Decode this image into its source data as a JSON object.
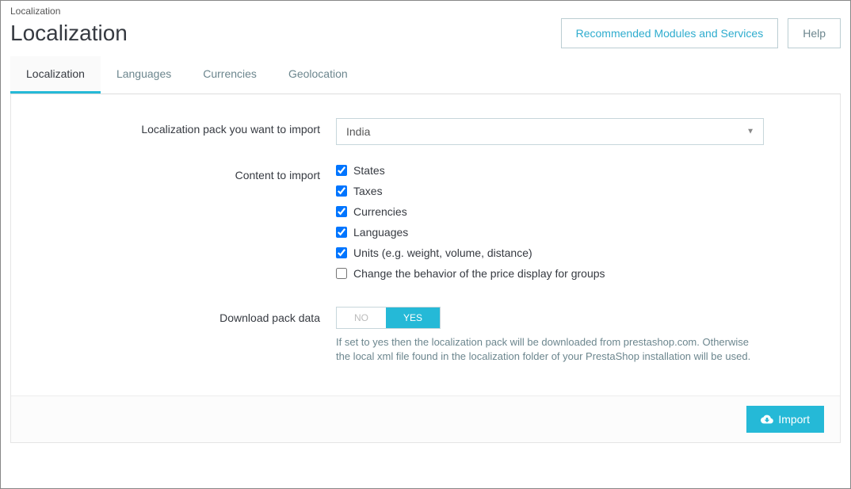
{
  "breadcrumb": "Localization",
  "page_title": "Localization",
  "header_buttons": {
    "recommended": "Recommended Modules and Services",
    "help": "Help"
  },
  "tabs": {
    "localization": "Localization",
    "languages": "Languages",
    "currencies": "Currencies",
    "geolocation": "Geolocation"
  },
  "form": {
    "pack_label": "Localization pack you want to import",
    "pack_value": "India",
    "content_label": "Content to import",
    "checks": {
      "states": "States",
      "taxes": "Taxes",
      "currencies": "Currencies",
      "languages": "Languages",
      "units": "Units (e.g. weight, volume, distance)",
      "price_behavior": "Change the behavior of the price display for groups"
    },
    "download_label": "Download pack data",
    "toggle_no": "NO",
    "toggle_yes": "YES",
    "download_help": "If set to yes then the localization pack will be downloaded from prestashop.com. Otherwise the local xml file found in the localization folder of your PrestaShop installation will be used."
  },
  "footer": {
    "import_button": "Import"
  }
}
